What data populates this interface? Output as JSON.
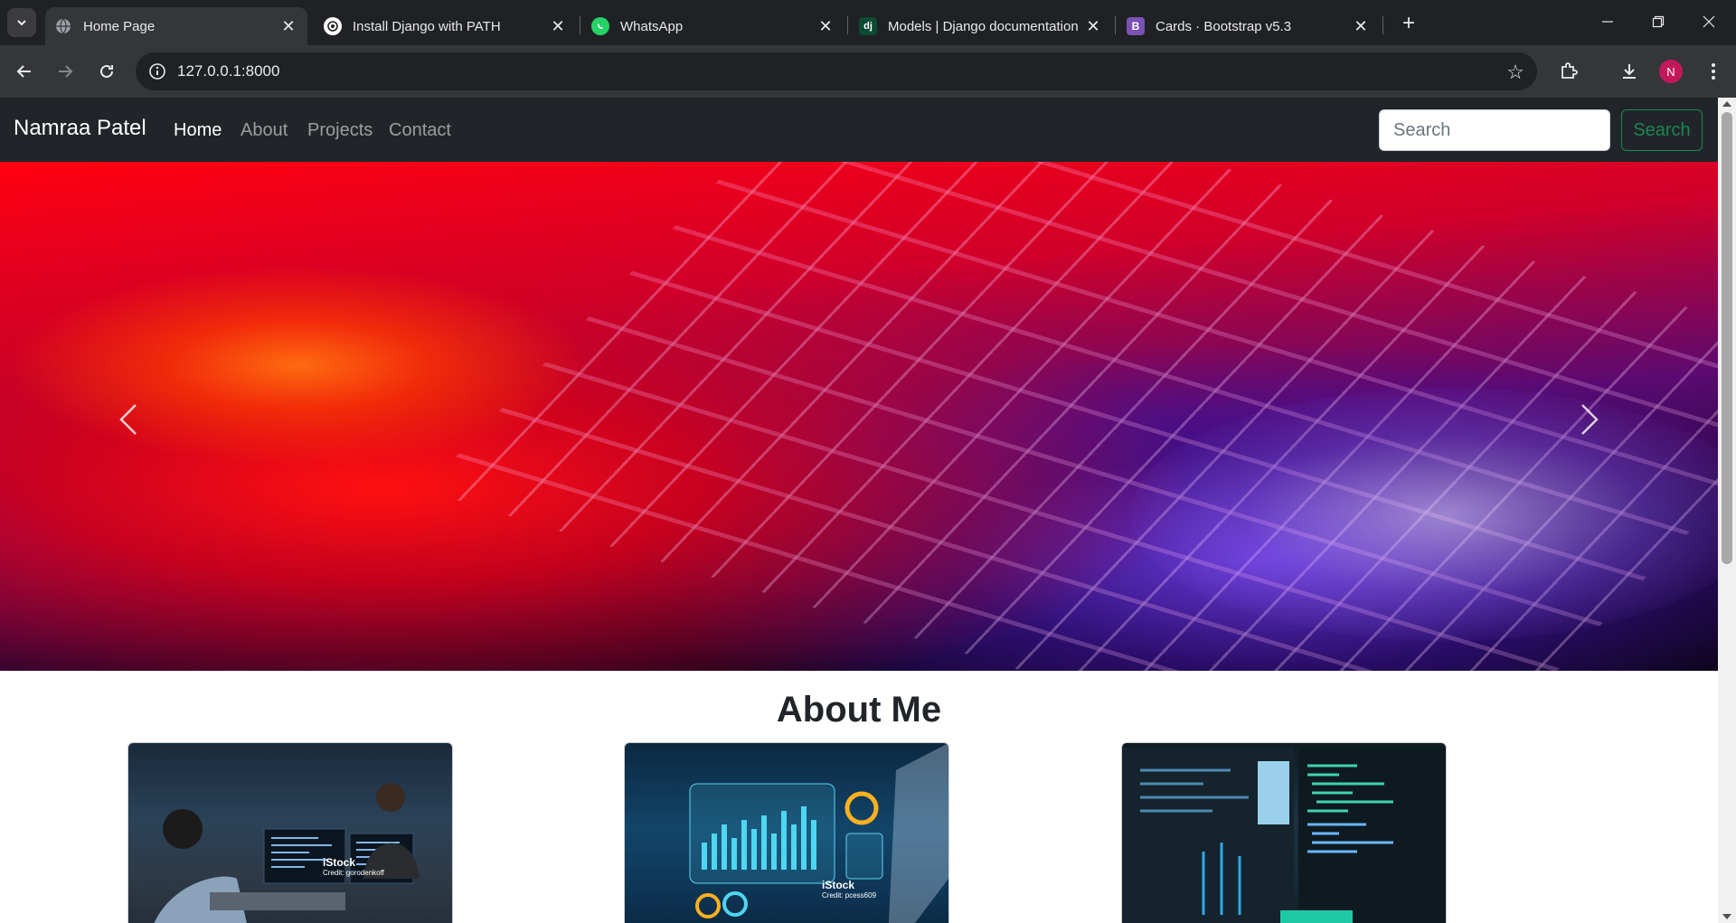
{
  "browser": {
    "tabs": [
      {
        "title": "Home Page",
        "icon": "globe-icon",
        "active": true
      },
      {
        "title": "Install Django with PATH",
        "icon": "openai-icon",
        "active": false
      },
      {
        "title": "WhatsApp",
        "icon": "whatsapp-icon",
        "active": false
      },
      {
        "title": "Models | Django documentation",
        "icon": "django-icon",
        "active": false
      },
      {
        "title": "Cards · Bootstrap v5.3",
        "icon": "bootstrap-icon",
        "active": false
      }
    ],
    "url": "127.0.0.1:8000",
    "profile_initial": "N",
    "profile_color": "#c2185b"
  },
  "navbar": {
    "brand": "Namraa Patel",
    "links": [
      "Home",
      "About",
      "Projects",
      "Contact"
    ],
    "active_link": "Home",
    "search_placeholder": "Search",
    "search_button": "Search",
    "search_button_color": "#198754"
  },
  "about": {
    "heading": "About Me",
    "cards": [
      {
        "image": "developers-at-computers-photo",
        "watermark": "iStock",
        "credit": "Credit: gorodenkoff"
      },
      {
        "image": "data-dashboard-photo",
        "watermark": "iStock",
        "credit": "Credit: pcess609"
      },
      {
        "image": "code-on-monitor-photo",
        "watermark": "",
        "credit": ""
      }
    ]
  }
}
